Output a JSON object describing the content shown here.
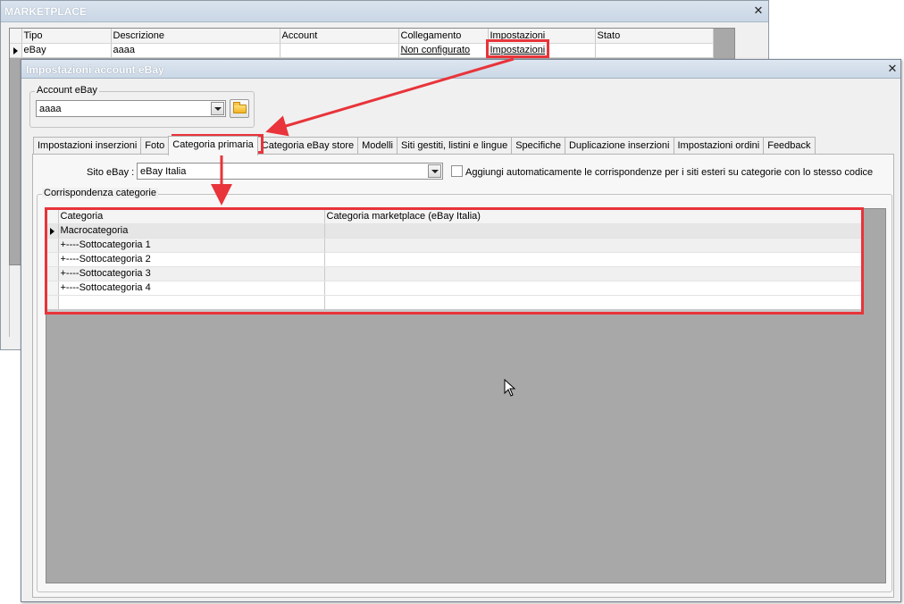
{
  "marketplace_window": {
    "title": "MARKETPLACE",
    "columns": [
      "Tipo",
      "Descrizione",
      "Account",
      "Collegamento",
      "Impostazioni",
      "Stato"
    ],
    "rows": [
      {
        "tipo": "eBay",
        "descrizione": "aaaa",
        "account": "",
        "collegamento": "Non configurato",
        "impostazioni": "Impostazioni",
        "stato": ""
      }
    ]
  },
  "dialog": {
    "title": "Impostazioni account eBay",
    "account_group_label": "Account eBay",
    "account_value": "aaaa",
    "tabs": [
      {
        "label": "Impostazioni inserzioni"
      },
      {
        "label": "Foto"
      },
      {
        "label": "Categoria primaria",
        "active": true
      },
      {
        "label": "Categoria eBay store"
      },
      {
        "label": "Modelli"
      },
      {
        "label": "Siti gestiti, listini e lingue"
      },
      {
        "label": "Specifiche"
      },
      {
        "label": "Duplicazione inserzioni"
      },
      {
        "label": "Impostazioni ordini"
      },
      {
        "label": "Feedback"
      }
    ],
    "site_label": "Sito eBay :",
    "site_value": "eBay Italia",
    "auto_match_label": "Aggiungi automaticamente le corrispondenze per i siti esteri su categorie con lo stesso codice",
    "auto_match_checked": false,
    "mapping_group_label": "Corrispondenza categorie",
    "mapping_columns": [
      "Categoria",
      "Categoria marketplace (eBay Italia)"
    ],
    "mapping_rows": [
      {
        "categoria": "Macrocategoria",
        "marketplace": ""
      },
      {
        "categoria": "+----Sottocategoria 1",
        "marketplace": ""
      },
      {
        "categoria": "+----Sottocategoria 2",
        "marketplace": ""
      },
      {
        "categoria": "+----Sottocategoria 3",
        "marketplace": ""
      },
      {
        "categoria": "+----Sottocategoria 4",
        "marketplace": ""
      }
    ]
  },
  "colors": {
    "highlight": "#e8343a"
  }
}
